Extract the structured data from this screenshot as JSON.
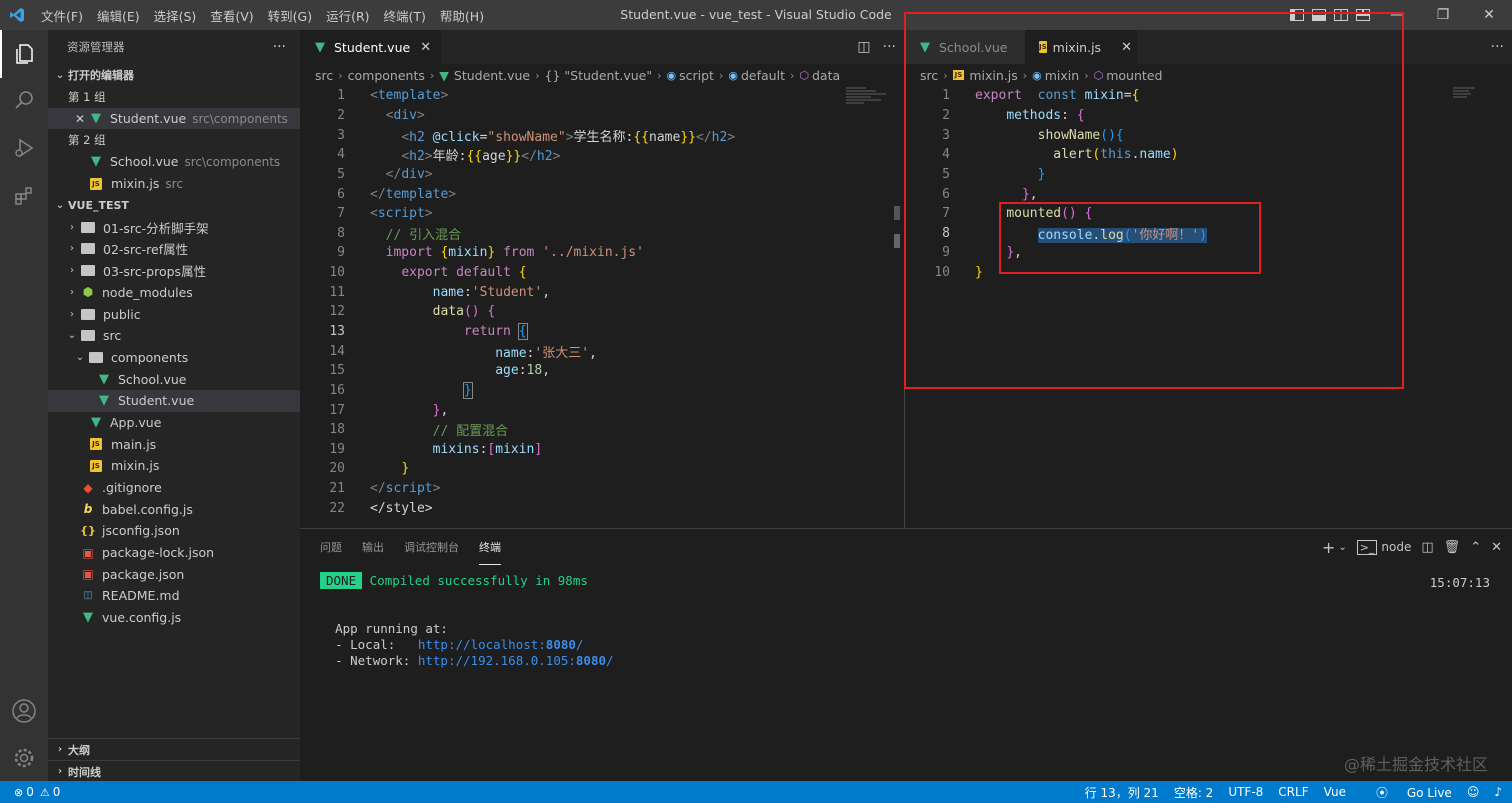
{
  "titlebar": {
    "menu": [
      "文件(F)",
      "编辑(E)",
      "选择(S)",
      "查看(V)",
      "转到(G)",
      "运行(R)",
      "终端(T)",
      "帮助(H)"
    ],
    "title": "Student.vue - vue_test - Visual Studio Code"
  },
  "sidebar": {
    "title": "资源管理器",
    "open_editors": "打开的编辑器",
    "group1": "第 1 组",
    "group2": "第 2 组",
    "open1": {
      "name": "Student.vue",
      "path": "src\\components"
    },
    "open2": {
      "name": "School.vue",
      "path": "src\\components"
    },
    "open3": {
      "name": "mixin.js",
      "path": "src"
    },
    "project": "VUE_TEST",
    "tree": {
      "f1": "01-src-分析脚手架",
      "f2": "02-src-ref属性",
      "f3": "03-src-props属性",
      "f4": "node_modules",
      "f5": "public",
      "f6": "src",
      "f7": "components",
      "f8": "School.vue",
      "f9": "Student.vue",
      "f10": "App.vue",
      "f11": "main.js",
      "f12": "mixin.js",
      "f13": ".gitignore",
      "f14": "babel.config.js",
      "f15": "jsconfig.json",
      "f16": "package-lock.json",
      "f17": "package.json",
      "f18": "README.md",
      "f19": "vue.config.js"
    },
    "outline": "大纲",
    "timeline": "时间线"
  },
  "left_editor": {
    "tab": "Student.vue",
    "crumbs": [
      "src",
      "components",
      "Student.vue",
      "{} \"Student.vue\"",
      "script",
      "default",
      "data"
    ],
    "current_line": 13
  },
  "right_editor": {
    "tab1": "School.vue",
    "tab2": "mixin.js",
    "crumbs": [
      "src",
      "mixin.js",
      "mixin",
      "mounted"
    ],
    "current_line": 8
  },
  "panel": {
    "tabs": [
      "问题",
      "输出",
      "调试控制台",
      "终端"
    ],
    "shell": "node",
    "done_badge": "DONE",
    "compiled": "Compiled successfully in 98ms",
    "time": "15:07:13",
    "running": "App running at:",
    "local_label": "- Local:   ",
    "local_url": "http://localhost:",
    "port": "8080",
    "network_label": "- Network: ",
    "network_url": "http://192.168.0.105:",
    "slash": "/",
    "watermark": "@稀土掘金技术社区"
  },
  "status": {
    "errors": "0",
    "warnings": "0",
    "position": "行 13，列 21",
    "spaces": "空格: 2",
    "encoding": "UTF-8",
    "eol": "CRLF",
    "language": "Vue",
    "golive": "Go Live"
  },
  "colors": {
    "accent": "#007acc",
    "annotation": "#e02020"
  }
}
